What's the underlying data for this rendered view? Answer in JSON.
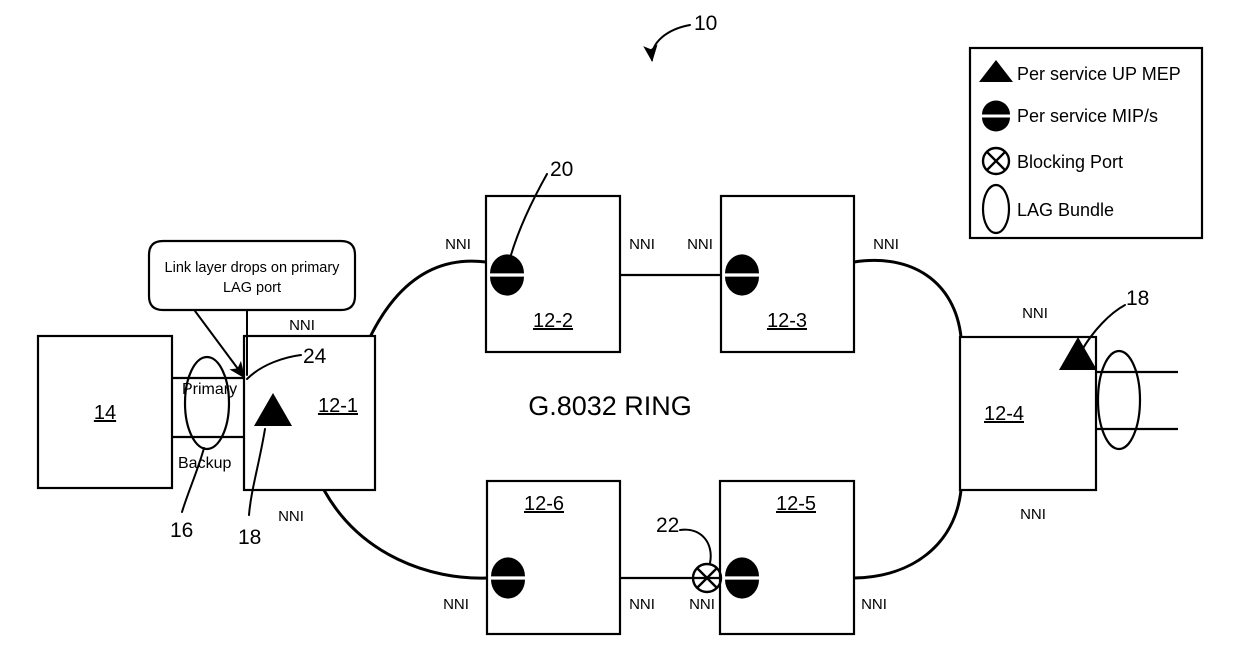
{
  "figure": {
    "reference_numeral": "10",
    "ring_label": "G.8032 RING"
  },
  "callout": {
    "line1": "Link layer drops on primary",
    "line2": "LAG port",
    "pointer_target_ref": "24"
  },
  "legend": {
    "items": [
      {
        "symbol": "triangle-icon",
        "label": "Per service UP MEP"
      },
      {
        "symbol": "split-circle-icon",
        "label": "Per service MIP/s"
      },
      {
        "symbol": "circle-x-icon",
        "label": "Blocking Port"
      },
      {
        "symbol": "ellipse-icon",
        "label": "LAG Bundle"
      }
    ]
  },
  "nodes": {
    "client": {
      "label": "14"
    },
    "n1": {
      "label": "12-1"
    },
    "n2": {
      "label": "12-2"
    },
    "n3": {
      "label": "12-3"
    },
    "n4": {
      "label": "12-4"
    },
    "n5": {
      "label": "12-5"
    },
    "n6": {
      "label": "12-6"
    }
  },
  "lag": {
    "left": {
      "primary_label": "Primary",
      "backup_label": "Backup",
      "ref": "16"
    },
    "right": {
      "ref": "18"
    }
  },
  "refs": {
    "mep_left": "18",
    "mep_right": "18",
    "mip_top": "20",
    "blocking_port": "22",
    "link_drop": "24"
  },
  "port_labels": {
    "nni": "NNI",
    "list": [
      {
        "id": "n1-top",
        "text": "NNI"
      },
      {
        "id": "n1-bottom",
        "text": "NNI"
      },
      {
        "id": "n2-left",
        "text": "NNI"
      },
      {
        "id": "n2-right",
        "text": "NNI"
      },
      {
        "id": "n3-left",
        "text": "NNI"
      },
      {
        "id": "n3-right",
        "text": "NNI"
      },
      {
        "id": "n4-top",
        "text": "NNI"
      },
      {
        "id": "n4-bottom",
        "text": "NNI"
      },
      {
        "id": "n5-right",
        "text": "NNI"
      },
      {
        "id": "n5-left",
        "text": "NNI"
      },
      {
        "id": "n6-right",
        "text": "NNI"
      },
      {
        "id": "n6-left",
        "text": "NNI"
      }
    ]
  },
  "colors": {
    "stroke": "#000000",
    "background": "#ffffff"
  }
}
